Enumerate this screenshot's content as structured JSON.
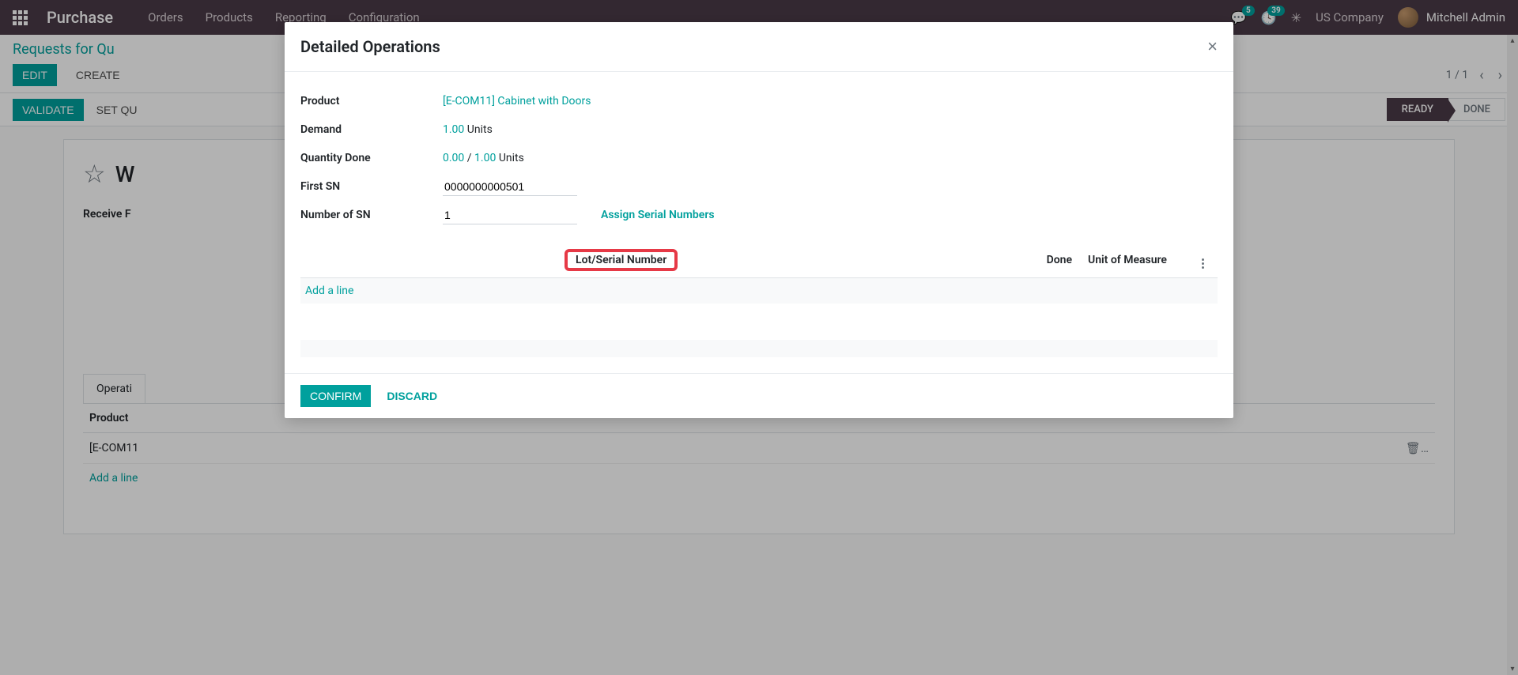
{
  "navbar": {
    "brand": "Purchase",
    "menu": [
      "Orders",
      "Products",
      "Reporting",
      "Configuration"
    ],
    "msg_badge": "5",
    "activity_badge": "39",
    "company": "US Company",
    "user": "Mitchell Admin"
  },
  "control_panel": {
    "breadcrumb": "Requests for Qu",
    "edit": "EDIT",
    "create": "CREATE",
    "pager": "1 / 1"
  },
  "statusbar": {
    "validate": "VALIDATE",
    "set_qty": "SET QU",
    "ready": "READY",
    "done": "DONE"
  },
  "form": {
    "title_partial": "W",
    "receive_from": "Receive F",
    "tab_operations": "Operati",
    "col_product": "Product",
    "row_product": "[E-COM11",
    "add_line": "Add a line"
  },
  "modal": {
    "title": "Detailed Operations",
    "labels": {
      "product": "Product",
      "demand": "Demand",
      "qty_done": "Quantity Done",
      "first_sn": "First SN",
      "num_sn": "Number of SN"
    },
    "values": {
      "product": "[E-COM11] Cabinet with Doors",
      "demand_qty": "1.00",
      "demand_unit": "Units",
      "done_qty": "0.00",
      "done_sep": "/",
      "done_total": "1.00",
      "done_unit": "Units",
      "first_sn": "0000000000501",
      "num_sn": "1"
    },
    "assign_link": "Assign Serial Numbers",
    "table_headers": {
      "lot": "Lot/Serial Number",
      "done": "Done",
      "uom": "Unit of Measure"
    },
    "add_line": "Add a line",
    "confirm": "CONFIRM",
    "discard": "DISCARD"
  }
}
